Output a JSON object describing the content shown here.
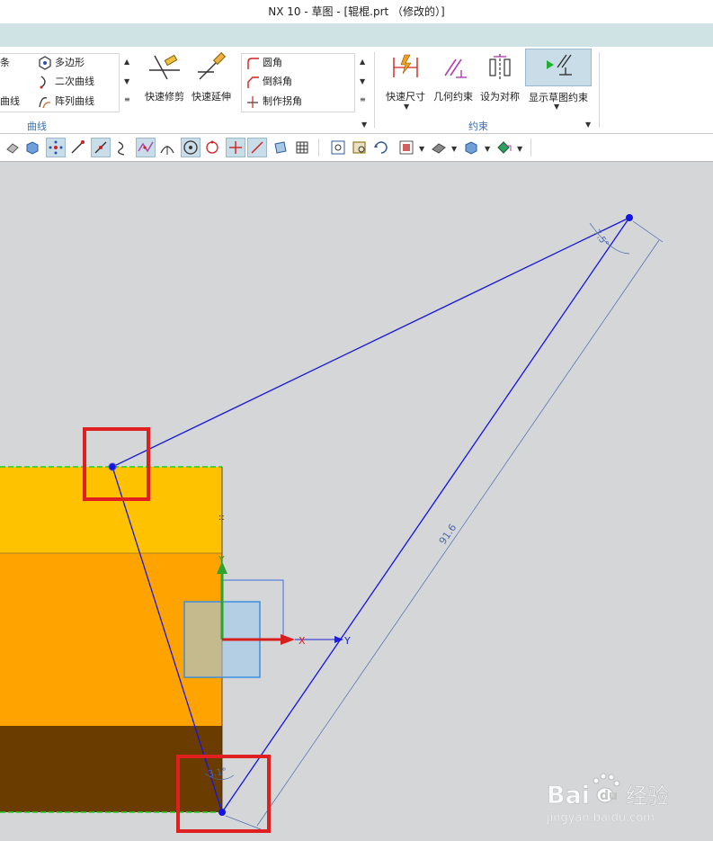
{
  "window": {
    "title": "NX 10 - 草图 - [辊棍.prt （修改的）]"
  },
  "ribbon": {
    "curve_group": {
      "items": [
        {
          "label": "条",
          "icon": "spline-icon"
        },
        {
          "label": "曲线",
          "icon": "curve-icon"
        },
        {
          "label": "多边形",
          "icon": "polygon-icon"
        },
        {
          "label": "二次曲线",
          "icon": "conic-icon"
        },
        {
          "label": "阵列曲线",
          "icon": "pattern-curve-icon"
        },
        {
          "label": "快速修剪",
          "icon": "quick-trim-icon"
        },
        {
          "label": "快速延伸",
          "icon": "quick-extend-icon"
        },
        {
          "label": "圆角",
          "icon": "fillet-icon"
        },
        {
          "label": "倒斜角",
          "icon": "chamfer-icon"
        },
        {
          "label": "制作拐角",
          "icon": "make-corner-icon"
        }
      ],
      "label": "曲线"
    },
    "constraint_group": {
      "items": [
        {
          "label": "快速尺寸",
          "icon": "rapid-dimension-icon"
        },
        {
          "label": "几何约束",
          "icon": "geometric-constraint-icon"
        },
        {
          "label": "设为对称",
          "icon": "make-symmetric-icon"
        },
        {
          "label": "显示草图约束",
          "icon": "show-constraints-icon"
        }
      ],
      "label": "约束"
    }
  },
  "canvas": {
    "dimension_length": "91.6",
    "dimension_angle_top": "7.5°",
    "dimension_angle_bottom": "3.1°",
    "axis_x_label": "X",
    "axis_y_label": "Y",
    "axis_y2_label": "Y"
  },
  "watermark": {
    "brand": "Bai",
    "brand2": "du",
    "cn": "经验",
    "url": "jingyan.baidu.com"
  },
  "colors": {
    "sketch_line": "#1515e0",
    "highlight_box": "#e02020",
    "band_top": "#ffc200",
    "band_mid": "#ffa300",
    "band_bottom": "#6b3c00",
    "background": "#d4d6d8"
  }
}
